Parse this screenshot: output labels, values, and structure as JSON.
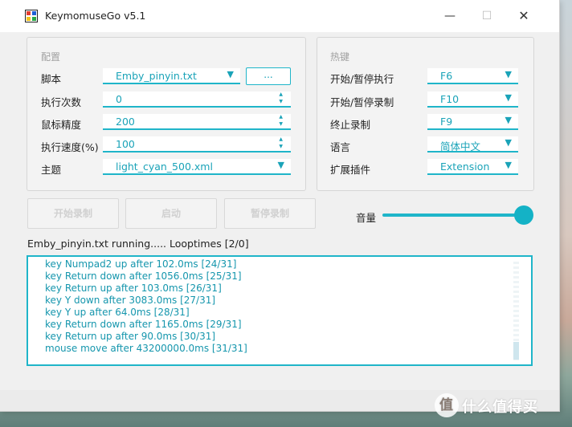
{
  "window": {
    "title": "KeymomuseGo v5.1"
  },
  "config": {
    "group_title": "配置",
    "script_label": "脚本",
    "script_value": "Emby_pinyin.txt",
    "browse_label": "...",
    "exec_count_label": "执行次数",
    "exec_count_value": "0",
    "mouse_precision_label": "鼠标精度",
    "mouse_precision_value": "200",
    "exec_speed_label": "执行速度(%)",
    "exec_speed_value": "100",
    "theme_label": "主题",
    "theme_value": "light_cyan_500.xml"
  },
  "hotkeys": {
    "group_title": "热键",
    "start_pause_exec_label": "开始/暂停执行",
    "start_pause_exec_value": "F6",
    "start_pause_record_label": "开始/暂停录制",
    "start_pause_record_value": "F10",
    "stop_record_label": "终止录制",
    "stop_record_value": "F9",
    "language_label": "语言",
    "language_value": "简体中文",
    "plugin_label": "扩展插件",
    "plugin_value": "Extension"
  },
  "buttons": {
    "start_record": "开始录制",
    "launch": "启动",
    "pause_record": "暂停录制"
  },
  "volume": {
    "label": "音量",
    "level_percent": 100
  },
  "status_text": "Emby_pinyin.txt running..... Looptimes [2/0]",
  "log_lines": [
    "key Numpad2 up after 102.0ms [24/31]",
    "key Return down after 1056.0ms [25/31]",
    "key Return up after 103.0ms [26/31]",
    "key Y down after 3083.0ms [27/31]",
    "key Y up after 64.0ms [28/31]",
    "key Return down after 1165.0ms [29/31]",
    "key Return up after 90.0ms [30/31]",
    "mouse move after 43200000.0ms [31/31]"
  ],
  "watermark": {
    "logo_glyph": "值",
    "text": "什么值得买"
  },
  "colors": {
    "accent": "#1fb5c9",
    "accent_text": "#1aa3b8",
    "disabled_text": "#d0d0d0"
  }
}
